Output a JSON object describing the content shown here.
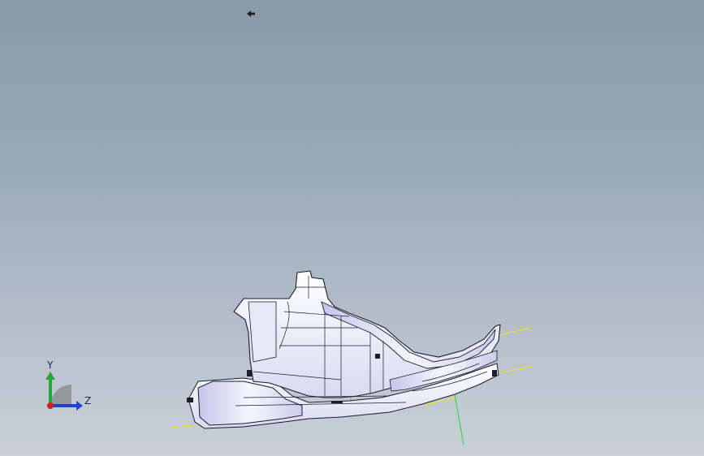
{
  "viewport": {
    "colors": {
      "background_top": "#8a99a9",
      "background_bottom": "#c9d0d8",
      "model_fill": "#f4f6fb",
      "model_shade": "#c6cbe8",
      "model_edge": "#1c1c2e",
      "sketch_yellow": "#f2e600",
      "sketch_green": "#2bd62b"
    },
    "icons": {
      "cursor": "move-cursor-icon"
    }
  },
  "triad": {
    "y_label": "Y",
    "z_label": "Z",
    "colors": {
      "y": "#2aa63a",
      "z": "#2040d0",
      "x": "#d02020",
      "base": "#888888"
    }
  }
}
